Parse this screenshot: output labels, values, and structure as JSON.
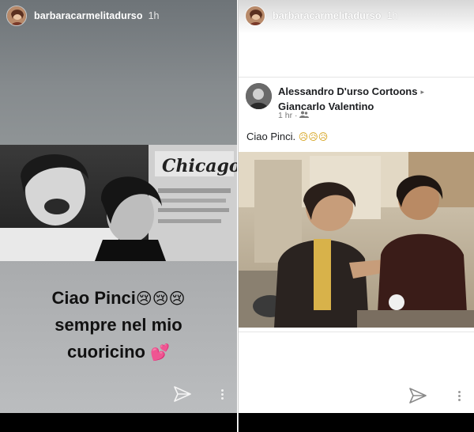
{
  "left_story": {
    "username": "barbaracarmelitadurso",
    "time": "1h",
    "text_lines": [
      "Ciao Pinci",
      "sempre nel mio",
      "cuoricino"
    ],
    "emojis": [
      "😢😢😢",
      "💕"
    ],
    "photo_signage": "Chicago"
  },
  "right_story": {
    "username": "barbaracarmelitadurso",
    "time": "1h",
    "post": {
      "author": "Alessandro D'urso Cortoons",
      "arrow": "▸",
      "target": "Giancarlo Valentino",
      "meta": "1 hr · ",
      "audience_icon": "friends-icon",
      "text": "Ciao Pinci. ",
      "text_emojis": "😥😥😥"
    }
  },
  "icons": {
    "send": "send-icon",
    "more": "more-icon"
  },
  "colors": {
    "story_text": "#111111",
    "bar": "#000000"
  }
}
